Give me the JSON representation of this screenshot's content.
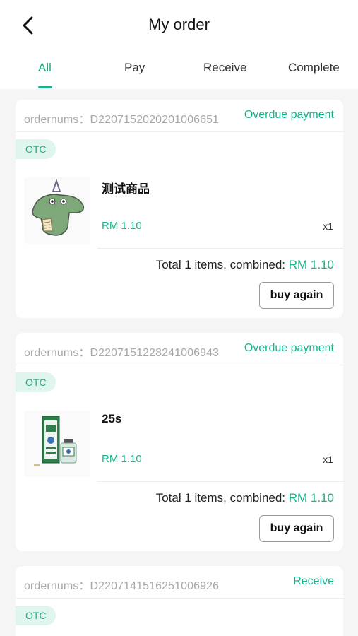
{
  "header": {
    "title": "My order"
  },
  "tabs": [
    {
      "label": "All",
      "active": true
    },
    {
      "label": "Pay"
    },
    {
      "label": "Receive"
    },
    {
      "label": "Complete"
    }
  ],
  "accent_color": "#16b28a",
  "orders": [
    {
      "ordernum": "ordernums：D2207152020201006651",
      "status": "Overdue payment",
      "badge": "OTC",
      "product": {
        "name": "测试商品",
        "price": "RM 1.10",
        "qty": "x1",
        "image": "crocodile-party-hat-sticker"
      },
      "total_label": "Total 1 items, combined: ",
      "total_amount": "RM 1.10",
      "button": "buy again"
    },
    {
      "ordernum": "ordernums：D2207151228241006943",
      "status": "Overdue payment",
      "badge": "OTC",
      "product": {
        "name": "25s",
        "price": "RM 1.10",
        "qty": "x1",
        "image": "medicated-oil-box-and-bottle"
      },
      "total_label": "Total 1 items, combined: ",
      "total_amount": "RM 1.10",
      "button": "buy again"
    },
    {
      "ordernum": "ordernums：D2207141516251006926",
      "status": "Receive",
      "badge": "OTC"
    }
  ]
}
